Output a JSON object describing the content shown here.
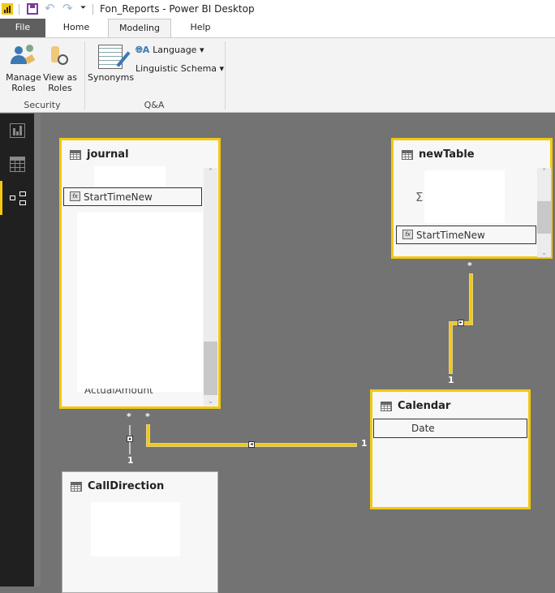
{
  "app": {
    "title": "Fon_Reports - Power BI Desktop",
    "accent": "#f2c811"
  },
  "tabs": [
    {
      "label": "File"
    },
    {
      "label": "Home"
    },
    {
      "label": "Modeling",
      "active": true
    },
    {
      "label": "Help"
    }
  ],
  "ribbon": {
    "manage_roles": "Manage Roles",
    "view_as_roles": "View as Roles",
    "security": "Security",
    "synonyms": "Synonyms",
    "language": "Language ▾",
    "linguistic_schema": "Linguistic Schema ▾",
    "qa": "Q&A"
  },
  "rail": [
    "report-view-icon",
    "data-view-icon",
    "relationships-view-icon"
  ],
  "tables": {
    "journal": {
      "name": "journal",
      "selected_field": "StartTimeNew",
      "partial_field": "ActualAmount"
    },
    "newTable": {
      "name": "newTable",
      "selected_field": "StartTimeNew",
      "sigma": "Σ"
    },
    "calendar": {
      "name": "Calendar",
      "selected_field": "Date"
    },
    "callDirection": {
      "name": "CallDirection"
    }
  },
  "relationships": [
    {
      "from": "newTable",
      "to": "Calendar",
      "from_card": "*",
      "to_card": "1"
    },
    {
      "from": "journal",
      "to": "Calendar",
      "from_card": "*",
      "to_card": "1"
    },
    {
      "from": "journal",
      "to": "CallDirection",
      "from_card": "*",
      "to_card": "1"
    }
  ]
}
